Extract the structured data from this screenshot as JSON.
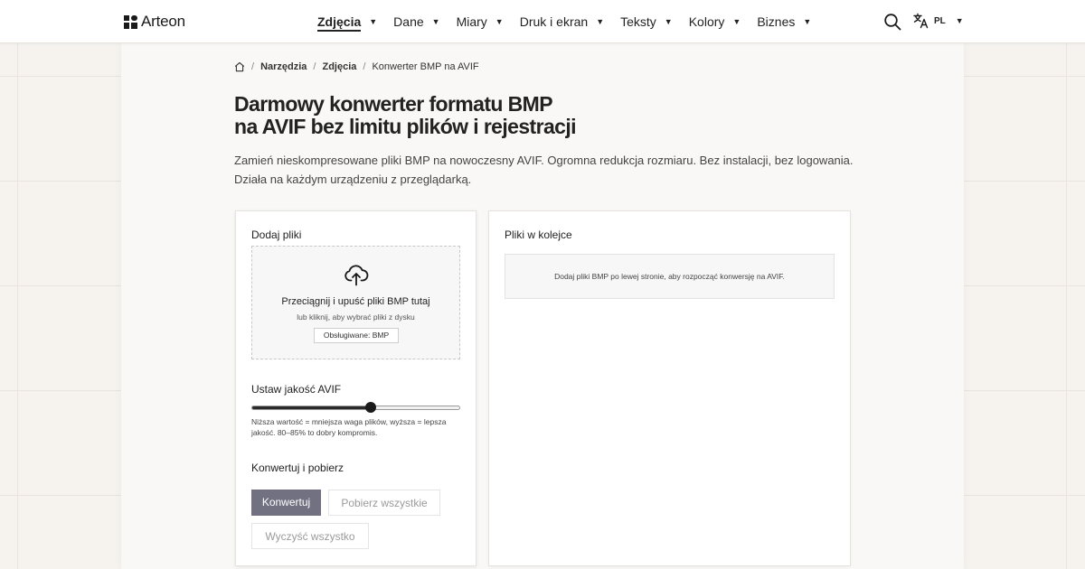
{
  "header": {
    "logo_text": "Arteon",
    "nav": [
      {
        "label": "Zdjęcia",
        "active": true
      },
      {
        "label": "Dane",
        "active": false
      },
      {
        "label": "Miary",
        "active": false
      },
      {
        "label": "Druk i ekran",
        "active": false
      },
      {
        "label": "Teksty",
        "active": false
      },
      {
        "label": "Kolory",
        "active": false
      },
      {
        "label": "Biznes",
        "active": false
      }
    ],
    "caret": "▼",
    "search_icon": "search-icon",
    "language": {
      "code": "PL",
      "icon": "translate-icon",
      "caret": "▼"
    }
  },
  "breadcrumb": {
    "home_icon": "home-icon",
    "separator": "/",
    "items": [
      "Narzędzia",
      "Zdjęcia"
    ],
    "current": "Konwerter BMP na AVIF"
  },
  "page": {
    "title_line1": "Darmowy konwerter formatu BMP",
    "title_line2": "na AVIF bez limitu plików i rejestracji",
    "subtitle_line1": "Zamień nieskompresowane pliki BMP na nowoczesny AVIF. Ogromna redukcja rozmiaru. Bez instalacji, bez logowania.",
    "subtitle_line2": "Działa na każdym urządzeniu z przeglądarką."
  },
  "upload": {
    "heading": "Dodaj pliki",
    "icon": "cloud-upload-icon",
    "main_text": "Przeciągnij i upuść pliki BMP tutaj",
    "sub_text": "lub kliknij, aby wybrać pliki z dysku",
    "supported": "Obsługiwane: BMP"
  },
  "quality": {
    "heading": "Ustaw jakość AVIF",
    "value_fraction": 0.57,
    "hint": "Niższa wartość = mniejsza waga plików, wyższa = lepsza jakość. 80–85% to dobry kompromis."
  },
  "actions": {
    "heading": "Konwertuj i pobierz",
    "convert": "Konwertuj",
    "download_all": "Pobierz wszystkie",
    "clear_all": "Wyczyść wszystko"
  },
  "queue": {
    "heading": "Pliki w kolejce",
    "empty_text": "Dodaj pliki BMP po lewej stronie, aby rozpocząć konwersję na AVIF."
  },
  "colors": {
    "primary_button": "#717182",
    "background": "#f6f3ef"
  }
}
